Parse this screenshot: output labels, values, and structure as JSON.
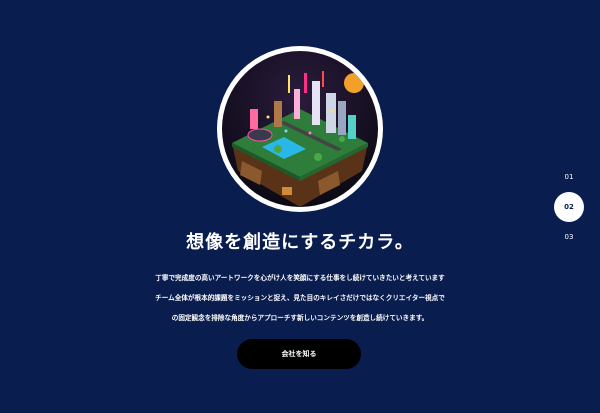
{
  "hero": {
    "headline": "想像を創造にするチカラ。",
    "body_lines": [
      "丁寧で完成度の高いアートワークを心がけ人を笑顔にする仕事をし続けていきたいと考えています",
      "チーム全体が根本的課題をミッションと捉え、見た目のキレイさだけではなくクリエイター視点で",
      "の固定観念を排除な角度からアプローチす新しいコンテンツを創造し続けていきます。"
    ],
    "cta_label": "会社を知る",
    "image_description_icon": "isometric-city-island-illustration"
  },
  "slide_nav": {
    "items": [
      "01",
      "02",
      "03"
    ],
    "active_index": 1
  },
  "colors": {
    "background": "#0a1d4f",
    "cta_background": "#000000",
    "text": "#ffffff"
  }
}
